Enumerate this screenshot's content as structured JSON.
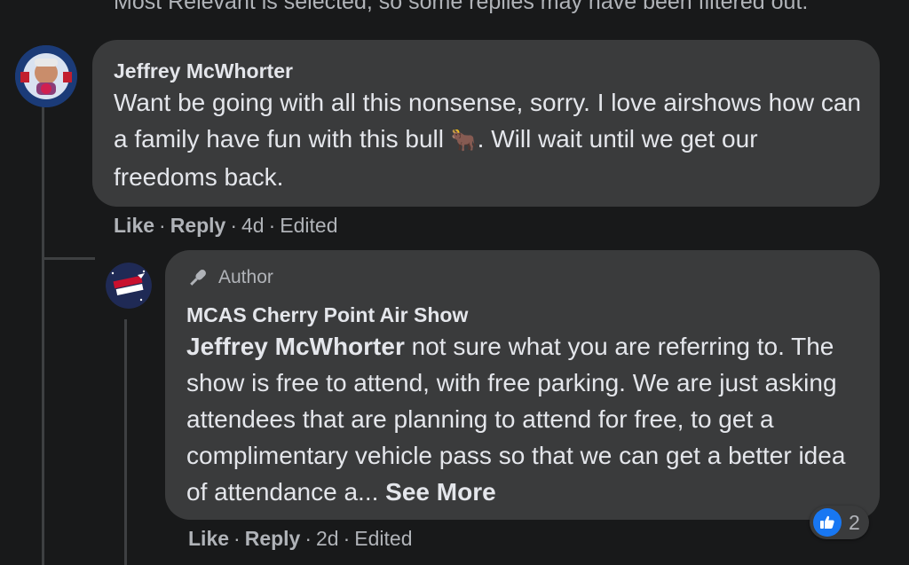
{
  "notice": "Most Relevant is selected, so some replies may have been filtered out.",
  "comment": {
    "author": "Jeffrey McWhorter",
    "text_before_emoji": "Want be going with all this nonsense, sorry. I love airshows how can a family have fun with this bull",
    "emoji": "🐂",
    "text_after_emoji": ". Will wait until we get our freedoms back.",
    "avatar_icon": "profile-photo-badge",
    "actions": {
      "like": "Like",
      "reply": "Reply",
      "time": "4d",
      "edited": "Edited"
    }
  },
  "reply": {
    "badge_icon": "microphone-icon",
    "badge_label": "Author",
    "author": "MCAS Cherry Point Air Show",
    "mention": "Jeffrey McWhorter",
    "text": " not sure what you are referring to. The show is free to attend, with free parking. We are just asking attendees that are planning to attend for free, to get a complimentary vehicle pass so that we can get a better idea of attendance a...",
    "see_more": "See More",
    "avatar_icon": "air-show-logo",
    "actions": {
      "like": "Like",
      "reply": "Reply",
      "time": "2d",
      "edited": "Edited"
    },
    "reaction": {
      "icon": "thumbs-up-icon",
      "count": "2",
      "color": "#1877f2"
    }
  },
  "colors": {
    "background": "#18191a",
    "bubble": "#3a3b3c",
    "muted": "#b0b3b8",
    "text": "#e4e6eb"
  }
}
